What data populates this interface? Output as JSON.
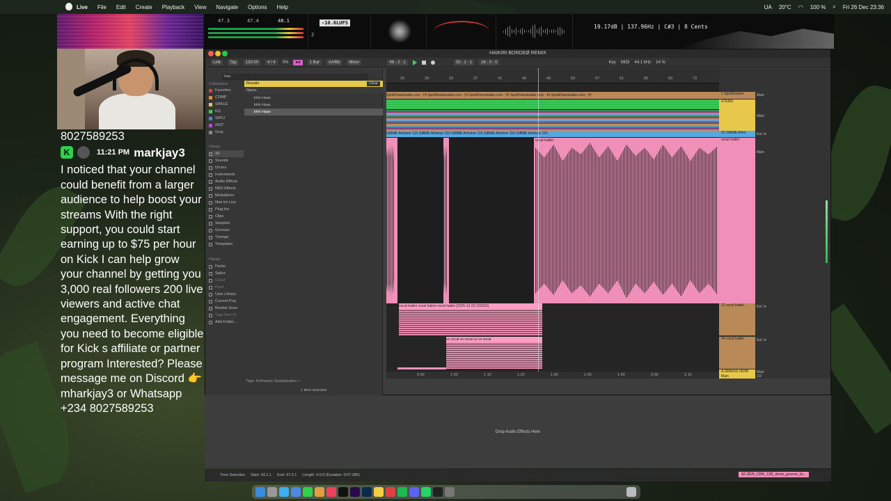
{
  "menubar": {
    "app": "Live",
    "items": [
      "File",
      "Edit",
      "Create",
      "Playback",
      "View",
      "Navigate",
      "Options",
      "Help"
    ],
    "lang": "UA",
    "temp": "20°C",
    "battery": "100 %",
    "datetime": "Fri 26 Dec 23:36"
  },
  "meters": {
    "lufs": "-10.6LUFS",
    "val_a": "47.3",
    "val_b": "47.4",
    "val_c": "48.1",
    "val_d": "2",
    "readout": "19.17dB | 137.96Hz | C#3 | 8 Cents"
  },
  "chat": {
    "phone_top": "8027589253",
    "time": "11:21 PM",
    "username": "markjay3",
    "message": "I noticed that your channel could benefit from a larger audience to help boost your streams With the right support, you could start earning up to $75 per hour on Kick I can help grow your channel by getting you 3,000 real followers 200 live viewers and active chat engagement. Everything you need to become eligible for Kick s affiliate or partner program Interested? Please message me on Discord 👉 mharkjay3 or Whatsapp +234 8027589253"
  },
  "ableton": {
    "title": "HAIKIRI BORDEØ REMIX",
    "toolbar": {
      "link": "Link",
      "tap": "Tap",
      "tempo": "130.00",
      "sig": "4 / 4",
      "cpu_pct": "0%",
      "bar": "1 Bar",
      "key": "A#/Bb",
      "scale": "Minor",
      "pos": "48 . 2 . 1",
      "loop_start": "33 . 1 . 1",
      "loop_len": "16 . 0 . 0",
      "key_label": "Key",
      "midi_label": "MIDI",
      "rate": "44.1 kHz",
      "load": "14 %"
    },
    "browser": {
      "search": "haa",
      "collections_title": "Collections",
      "collections": [
        {
          "label": "Favorites",
          "color": "#e04040"
        },
        {
          "label": "COMP",
          "color": "#f08a30"
        },
        {
          "label": "SPACE",
          "color": "#e8c84a"
        },
        {
          "label": "EQ",
          "color": "#4ac65a"
        },
        {
          "label": "SATU",
          "color": "#3a8ce0"
        },
        {
          "label": "INST",
          "color": "#b04ae0"
        },
        {
          "label": "Gray",
          "color": "#888888"
        }
      ],
      "library_title": "Library",
      "library": [
        "All",
        "Sounds",
        "Drums",
        "Instruments",
        "Audio Effects",
        "MIDI Effects",
        "Modulators",
        "Max for Live",
        "Plug-Ins",
        "Clips",
        "Samples",
        "Grooves",
        "Tunings",
        "Templates"
      ],
      "places_title": "Places",
      "places": [
        "Packs",
        "Splice",
        "Cloud",
        "Push",
        "User Library",
        "Current Proj.",
        "Bordee Soun",
        "Tags Nick Pr",
        "Add Folder..."
      ],
      "results_label": "Results",
      "clear_label": "Clear",
      "name_header": "Name",
      "results": [
        "kHs Haas",
        "kHs Haas",
        "kHs Haas"
      ],
      "tags": "Tags:  Kilohearts   Spatialization  ×",
      "selected_count": "1 item selected"
    },
    "arrangement": {
      "bar_numbers": [
        "25",
        "29",
        "33",
        "37",
        "41",
        "45",
        "49",
        "53",
        "57",
        "61",
        "65",
        "69",
        "73"
      ],
      "orange_label": "SpotiDownloader.com - Hi SpotiDownloader.com - Hi SpotiDownloader.com - Hi SpotiDownloader.com - Hi SpotiDownloader.com - Hi",
      "blue_label": "GIBME A#minor 115     GIBME A#minor 115     GIBME A#minor 115     GIBME A#minor 115     GIBME A#minor 115",
      "vocal_clip": "vocal haikiri",
      "vh_label": "vocal haikiri  vocal haikiri  vocal haikiri [2025-12-26 223003]",
      "vh2_label": "vo vocal  vo vocal  vo  vo vocal",
      "time_marks": [
        "0:50",
        "1:00",
        "1:10",
        "1:20",
        "1:30",
        "1:40",
        "1:50",
        "2:00",
        "2:10"
      ]
    },
    "tracks": [
      {
        "name": "1 SpotiDownlo",
        "color": "#b98a58",
        "io": "Main"
      },
      {
        "name": "STEMS",
        "color": "#e8c84a",
        "io": "Main"
      },
      {
        "name": "21 GIBME A#mi",
        "color": "#5aa7e0",
        "io": "Ext. In"
      },
      {
        "name": "vocal haikiri",
        "color": "#f090b8",
        "io": "Main"
      },
      {
        "name": "23 vocal haikiri",
        "color": "#b98a58",
        "io": "Ext. In"
      },
      {
        "name": "24 vocal haikiri",
        "color": "#b98a58",
        "io": "Ext. In"
      },
      {
        "name": "A ZEBASS VERB",
        "color": "#e8c84a",
        "io": "Main"
      },
      {
        "name": "Main",
        "color": "#e8c84a",
        "io": "1/2"
      }
    ],
    "drop_text": "Drop Audio Effects Here",
    "status": {
      "mode": "Time Selection",
      "start": "Start: 43.1.1",
      "end": "End: 47.3.1",
      "length": "Length: 4.0.0 (Duration: 0:07:385)",
      "clip": "32-ZEN_CRK_130_drum_groove_lo..."
    }
  },
  "dock": {
    "apps": [
      "finder",
      "launchpad",
      "safari",
      "mail",
      "messages",
      "photos",
      "music",
      "live",
      "premiere",
      "lightroom",
      "notes",
      "chrome",
      "spotify",
      "discord",
      "whatsapp",
      "terminal",
      "settings",
      "trash"
    ]
  }
}
